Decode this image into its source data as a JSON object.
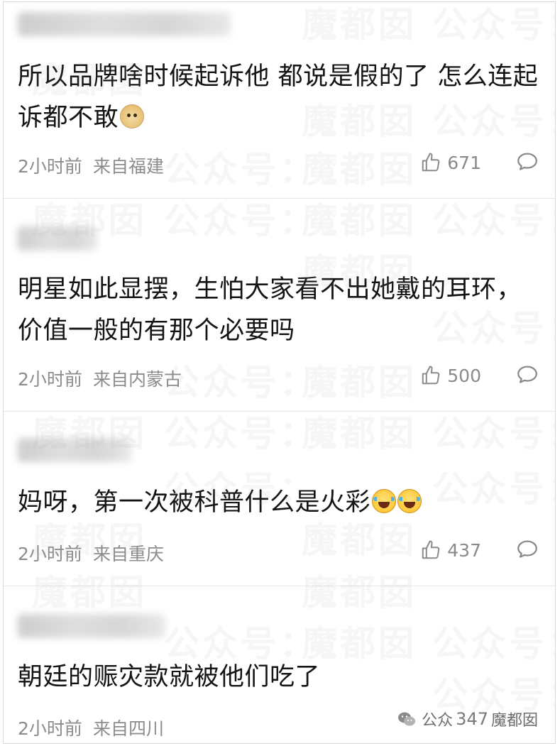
{
  "comments": [
    {
      "text": "所以品牌啥时候起诉他 都说是假的了 怎么连起诉都不敢",
      "emoji": "doge",
      "time": "2小时前",
      "location": "来自福建",
      "likes": "671"
    },
    {
      "text": "明星如此显摆，生怕大家看不出她戴的耳环，价值一般的有那个必要吗",
      "emoji": "",
      "time": "2小时前",
      "location": "来自内蒙古",
      "likes": "500"
    },
    {
      "text": "妈呀，第一次被科普什么是火彩",
      "emoji": "laugh-cry-x2",
      "time": "2小时前",
      "location": "来自重庆",
      "likes": "437"
    },
    {
      "text": "朝廷的赈灾款就被他们吃了",
      "emoji": "",
      "time": "2小时前",
      "location": "来自四川",
      "likes": ""
    }
  ],
  "watermark": {
    "a": "魔都囡",
    "b": "公众号："
  },
  "footer": {
    "brand_prefix": "公众",
    "count": "347",
    "brand_suffix": "魔都囡"
  },
  "icons": {
    "like": "thumbs-up-icon",
    "reply": "comment-bubble-icon",
    "brand": "wechat-icon"
  },
  "colors": {
    "text": "#141414",
    "meta": "#8c8c8c",
    "divider": "#e6e6e6"
  }
}
